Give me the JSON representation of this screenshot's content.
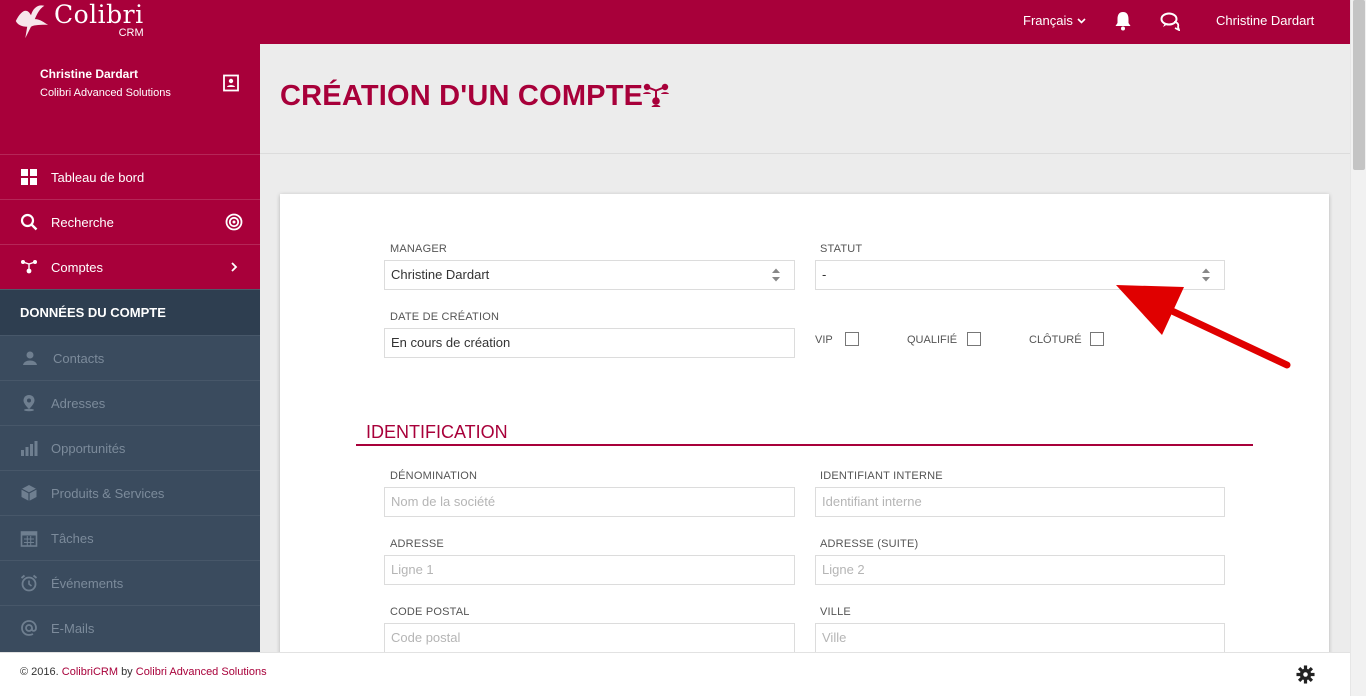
{
  "app": {
    "logo_title": "Colibri",
    "logo_sub": "CRM"
  },
  "topbar": {
    "language": "Français",
    "user_name": "Christine Dardart"
  },
  "profile": {
    "name": "Christine Dardart",
    "company": "Colibri Advanced Solutions"
  },
  "sidebar": {
    "main_items": [
      {
        "label": "Tableau de bord",
        "icon": "grid-icon"
      },
      {
        "label": "Recherche",
        "icon": "search-icon"
      },
      {
        "label": "Comptes",
        "icon": "accounts-icon"
      }
    ],
    "section_header": "DONNÉES DU COMPTE",
    "sub_items": [
      {
        "label": "Contacts",
        "icon": "contact-icon"
      },
      {
        "label": "Adresses",
        "icon": "map-pin-icon"
      },
      {
        "label": "Opportunités",
        "icon": "bar-chart-icon"
      },
      {
        "label": "Produits & Services",
        "icon": "cube-icon"
      },
      {
        "label": "Tâches",
        "icon": "calendar-icon"
      },
      {
        "label": "Événements",
        "icon": "alarm-clock-icon"
      },
      {
        "label": "E-Mails",
        "icon": "at-icon"
      }
    ]
  },
  "page": {
    "title": "CRÉATION D'UN COMPTE"
  },
  "form": {
    "manager": {
      "label": "MANAGER",
      "value": "Christine Dardart"
    },
    "statut": {
      "label": "STATUT",
      "value": "-"
    },
    "date_creation": {
      "label": "DATE DE CRÉATION",
      "value": "En cours de création"
    },
    "checkboxes": {
      "vip": "VIP",
      "qualifie": "QUALIFIÉ",
      "cloture": "CLÔTURÉ"
    },
    "section_title": "IDENTIFICATION",
    "denomination": {
      "label": "DÉNOMINATION",
      "placeholder": "Nom de la société"
    },
    "identifiant": {
      "label": "IDENTIFIANT INTERNE",
      "placeholder": "Identifiant interne"
    },
    "adresse": {
      "label": "ADRESSE",
      "placeholder": "Ligne 1"
    },
    "adresse_suite": {
      "label": "ADRESSE (SUITE)",
      "placeholder": "Ligne 2"
    },
    "code_postal": {
      "label": "CODE POSTAL",
      "placeholder": "Code postal"
    },
    "ville": {
      "label": "VILLE",
      "placeholder": "Ville"
    }
  },
  "footer": {
    "copyright": "© 2016.",
    "link1": "ColibriCRM",
    "by": "by",
    "link2": "Colibri Advanced Solutions"
  },
  "colors": {
    "brand": "#a8003a",
    "sidebar_dark": "#2e3e50",
    "sidebar_muted": "#3a4b5e",
    "annotation_arrow": "#e00000"
  }
}
